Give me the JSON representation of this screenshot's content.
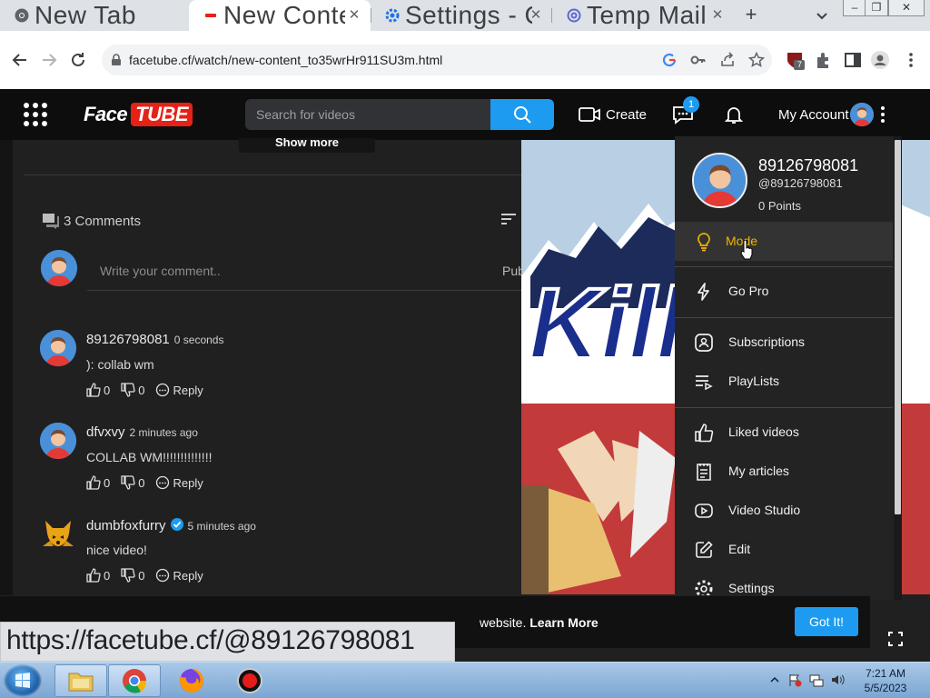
{
  "browser": {
    "tabs": [
      {
        "title": "New Tab",
        "icon": "chrome-icon"
      },
      {
        "title": "New Content",
        "icon": "facetube-icon"
      },
      {
        "title": "Settings - Chrome",
        "icon": "settings-gear-icon"
      },
      {
        "title": "Temp Mail",
        "icon": "at-sign-icon"
      }
    ],
    "url_display": "facetube.cf/watch/new-content_to35wrHr911SU3m.html",
    "status_url": "https://facetube.cf/@89126798081",
    "extension_badge": "7"
  },
  "site": {
    "logo_face": "Face",
    "logo_tube": "TUBE",
    "search_placeholder": "Search for videos",
    "create_label": "Create",
    "messages_badge": "1",
    "account_label": "My Account"
  },
  "content": {
    "show_more": "Show more",
    "comments_title": "3 Comments",
    "comment_placeholder": "Write your comment..",
    "publish_label": "Pub",
    "comments": [
      {
        "author": "89126798081",
        "time": "0 seconds",
        "text": "): collab wm",
        "likes": "0",
        "dislikes": "0",
        "reply": "Reply",
        "verified": false
      },
      {
        "author": "dfvxvy",
        "time": "2 minutes ago",
        "text": "COLLAB WM!!!!!!!!!!!!!!",
        "likes": "0",
        "dislikes": "0",
        "reply": "Reply",
        "verified": false
      },
      {
        "author": "dumbfoxfurry",
        "time": "5 minutes ago",
        "text": "nice video!",
        "likes": "0",
        "dislikes": "0",
        "reply": "Reply",
        "verified": true
      }
    ]
  },
  "account_menu": {
    "name": "89126798081",
    "handle": "@89126798081",
    "points": "0 Points",
    "items": [
      {
        "label": "Mode",
        "icon": "lightbulb-icon"
      },
      {
        "label": "Go Pro",
        "icon": "lightning-icon"
      },
      {
        "label": "Subscriptions",
        "icon": "subscriptions-icon"
      },
      {
        "label": "PlayLists",
        "icon": "playlist-icon"
      },
      {
        "label": "Liked videos",
        "icon": "thumbs-up-icon"
      },
      {
        "label": "My articles",
        "icon": "articles-icon"
      },
      {
        "label": "Video Studio",
        "icon": "video-studio-icon"
      },
      {
        "label": "Edit",
        "icon": "edit-icon"
      },
      {
        "label": "Settings",
        "icon": "settings-gear-icon"
      }
    ]
  },
  "cookie_bar": {
    "text_tail": "website.",
    "learn_more": "Learn More",
    "got_it": "Got It!"
  },
  "taskbar": {
    "time": "7:21 AM",
    "date": "5/5/2023"
  },
  "colors": {
    "accent": "#1d9bf0",
    "logo_red": "#e62117",
    "highlight_yellow": "#f4b400"
  }
}
